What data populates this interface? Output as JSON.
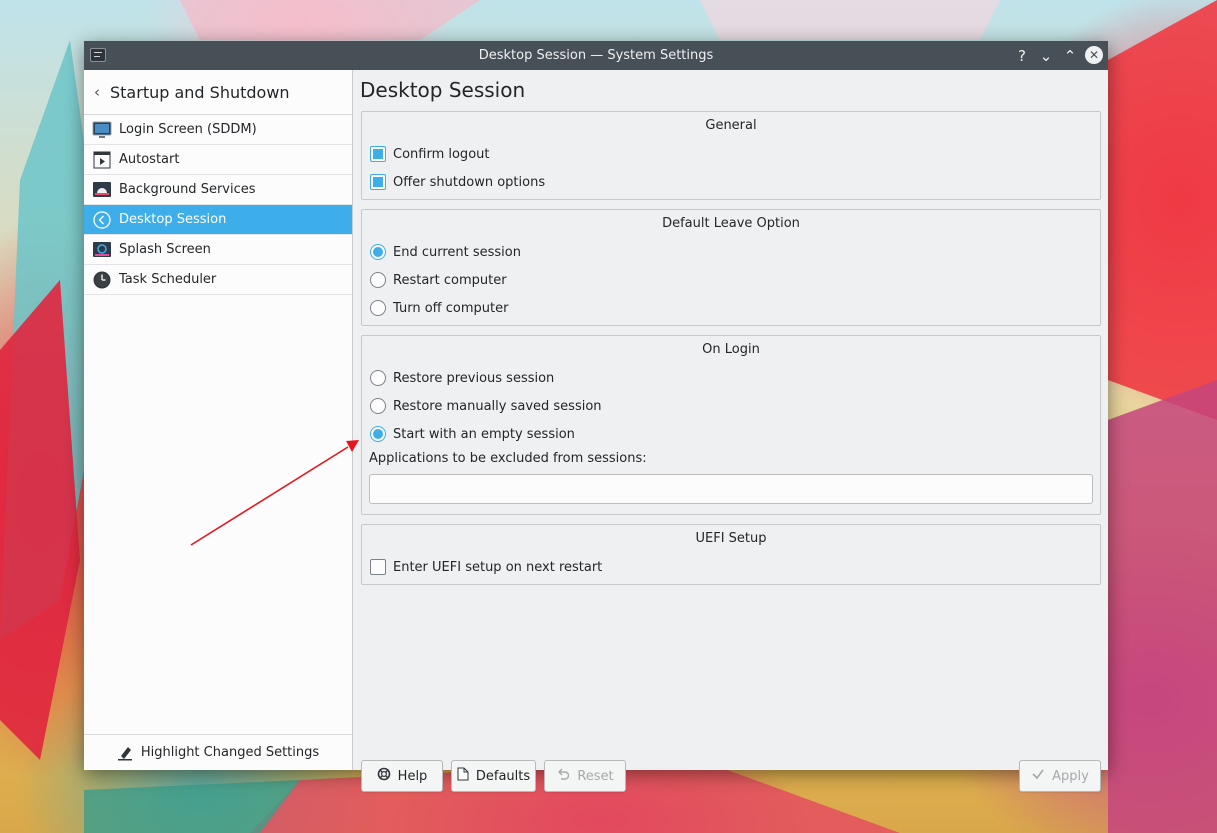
{
  "window": {
    "title": "Desktop Session — System Settings",
    "help_glyph": "?",
    "minimize_glyph": "⌄",
    "maximize_glyph": "⌃",
    "close_glyph": "✕"
  },
  "sidebar": {
    "back_glyph": "‹",
    "title": "Startup and Shutdown",
    "items": [
      {
        "label": "Login Screen (SDDM)",
        "icon": "monitor-icon"
      },
      {
        "label": "Autostart",
        "icon": "autostart-icon"
      },
      {
        "label": "Background Services",
        "icon": "background-services-icon"
      },
      {
        "label": "Desktop Session",
        "icon": "desktop-session-icon",
        "active": true
      },
      {
        "label": "Splash Screen",
        "icon": "splash-screen-icon"
      },
      {
        "label": "Task Scheduler",
        "icon": "clock-icon"
      }
    ],
    "footer_label": "Highlight Changed Settings"
  },
  "main": {
    "title": "Desktop Session",
    "general": {
      "title": "General",
      "confirm_logout": "Confirm logout",
      "offer_shutdown": "Offer shutdown options"
    },
    "leave": {
      "title": "Default Leave Option",
      "end_session": "End current session",
      "restart": "Restart computer",
      "turn_off": "Turn off computer"
    },
    "login": {
      "title": "On Login",
      "restore_previous": "Restore previous session",
      "restore_saved": "Restore manually saved session",
      "start_empty": "Start with an empty session",
      "excluded_label": "Applications to be excluded from sessions:",
      "excluded_value": ""
    },
    "uefi": {
      "title": "UEFI Setup",
      "enter_uefi": "Enter UEFI setup on next restart"
    }
  },
  "buttons": {
    "help": "Help",
    "defaults": "Defaults",
    "reset": "Reset",
    "apply": "Apply"
  },
  "colors": {
    "accent": "#3daee9",
    "titlebar": "#475057",
    "annotation_arrow": "#e8141b"
  }
}
